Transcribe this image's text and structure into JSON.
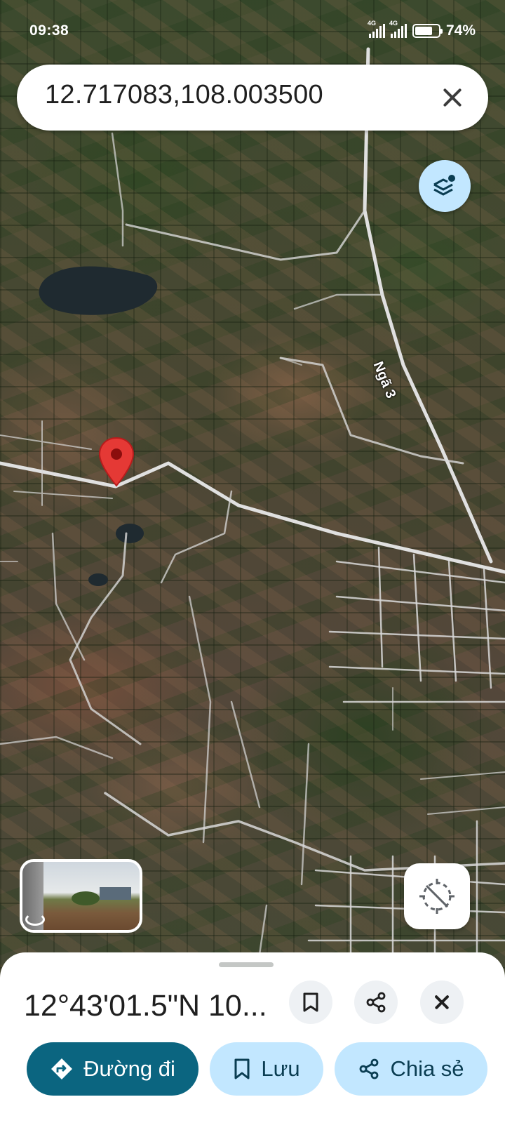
{
  "status_bar": {
    "time": "09:38",
    "network_1": "4G",
    "network_2": "4G",
    "battery": "74%",
    "battery_level": 0.74
  },
  "search": {
    "query": "12.717083,108.003500"
  },
  "map": {
    "road_label": "Ngã 3",
    "pin_color": "#e53935"
  },
  "sheet": {
    "title": "12°43'01.5\"N 10...",
    "directions_label": "Đường đi",
    "save_label": "Lưu",
    "share_label": "Chia sẻ"
  },
  "icons": {
    "layers": "layers-icon",
    "locate": "location-disabled-icon",
    "bookmark": "bookmark-icon",
    "share": "share-icon",
    "close": "close-icon",
    "directions": "directions-icon",
    "street_view": "street-view-icon"
  },
  "colors": {
    "primary_button": "#0b6580",
    "secondary_button": "#c2e7ff"
  }
}
